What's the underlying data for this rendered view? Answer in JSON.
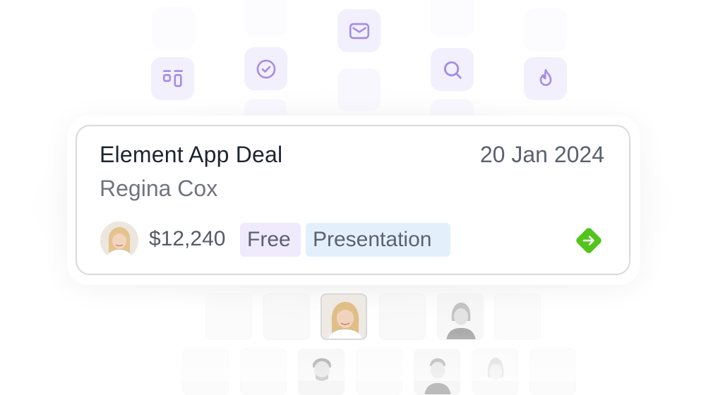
{
  "icons": [
    "mail-icon",
    "check-circle-icon",
    "search-icon",
    "dashboard-icon",
    "flame-icon"
  ],
  "deal": {
    "title": "Element App Deal",
    "date": "20 Jan 2024",
    "person": "Regina Cox",
    "amount": "$12,240",
    "tags": [
      "Free",
      "Presentation"
    ]
  },
  "colors": {
    "accent_green": "#52c41a",
    "icon_purple": "#a48be8",
    "tile_bg": "#f3f0fd"
  }
}
